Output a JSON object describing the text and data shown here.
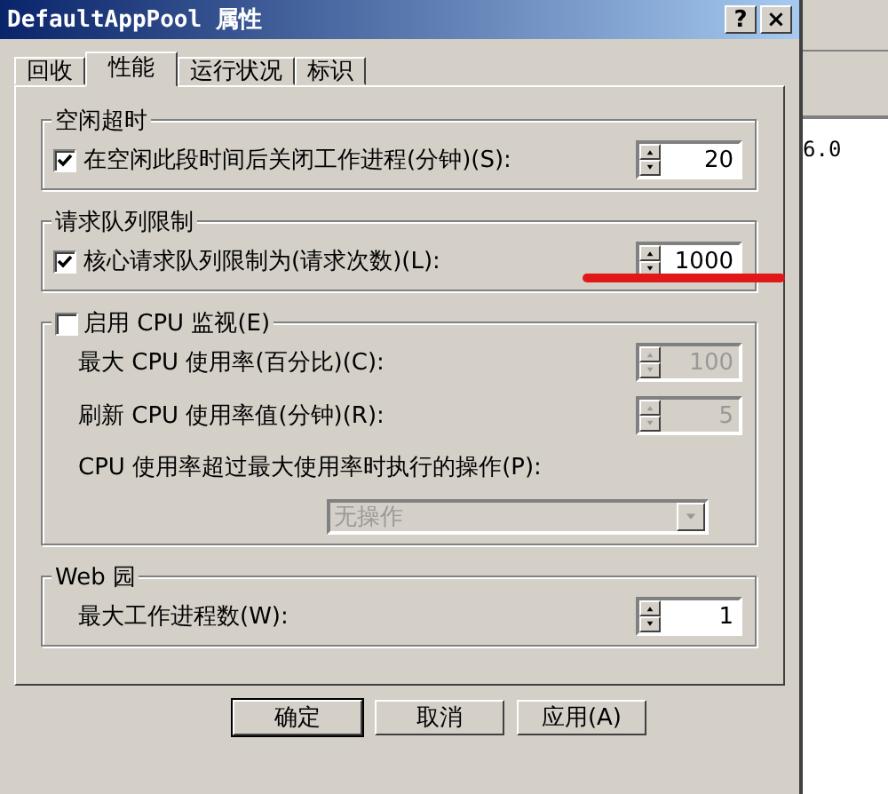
{
  "window": {
    "title": "DefaultAppPool 属性",
    "help_button": "?",
    "close_button": "×"
  },
  "tabs": [
    {
      "label": "回收",
      "selected": false
    },
    {
      "label": "性能",
      "selected": true
    },
    {
      "label": "运行状况",
      "selected": false
    },
    {
      "label": "标识",
      "selected": false
    }
  ],
  "groups": [
    {
      "title": "空闲超时",
      "rows": [
        {
          "kind": "spin",
          "label": "在空闲此段时间后关闭工作进程(分钟)(S):",
          "checked": true,
          "value": "20",
          "disabled": false
        }
      ]
    },
    {
      "title": "请求队列限制",
      "rows": [
        {
          "kind": "spin",
          "label": "核心请求队列限制为(请求次数)(L):",
          "checked": true,
          "value": "1000",
          "disabled": false
        }
      ]
    },
    {
      "title": "启用 CPU 监视(E)",
      "title_checked": false,
      "rows": [
        {
          "kind": "spin",
          "label": "最大 CPU 使用率(百分比)(C):",
          "value": "100",
          "disabled": true
        },
        {
          "kind": "spin",
          "label": "刷新 CPU 使用率值(分钟)(R):",
          "value": "5",
          "disabled": true
        },
        {
          "kind": "label",
          "label": "CPU 使用率超过最大使用率时执行的操作(P):"
        },
        {
          "kind": "dropdown",
          "value": "无操作",
          "disabled": true
        }
      ]
    },
    {
      "title": "Web 园",
      "rows": [
        {
          "kind": "spin",
          "label": "最大工作进程数(W):",
          "value": "1",
          "disabled": false
        }
      ]
    }
  ],
  "buttons": [
    {
      "label": "确定",
      "default": true
    },
    {
      "label": "取消",
      "default": false
    },
    {
      "label": "应用(A)",
      "default": false
    }
  ],
  "background_window": {
    "text": "6.0"
  }
}
